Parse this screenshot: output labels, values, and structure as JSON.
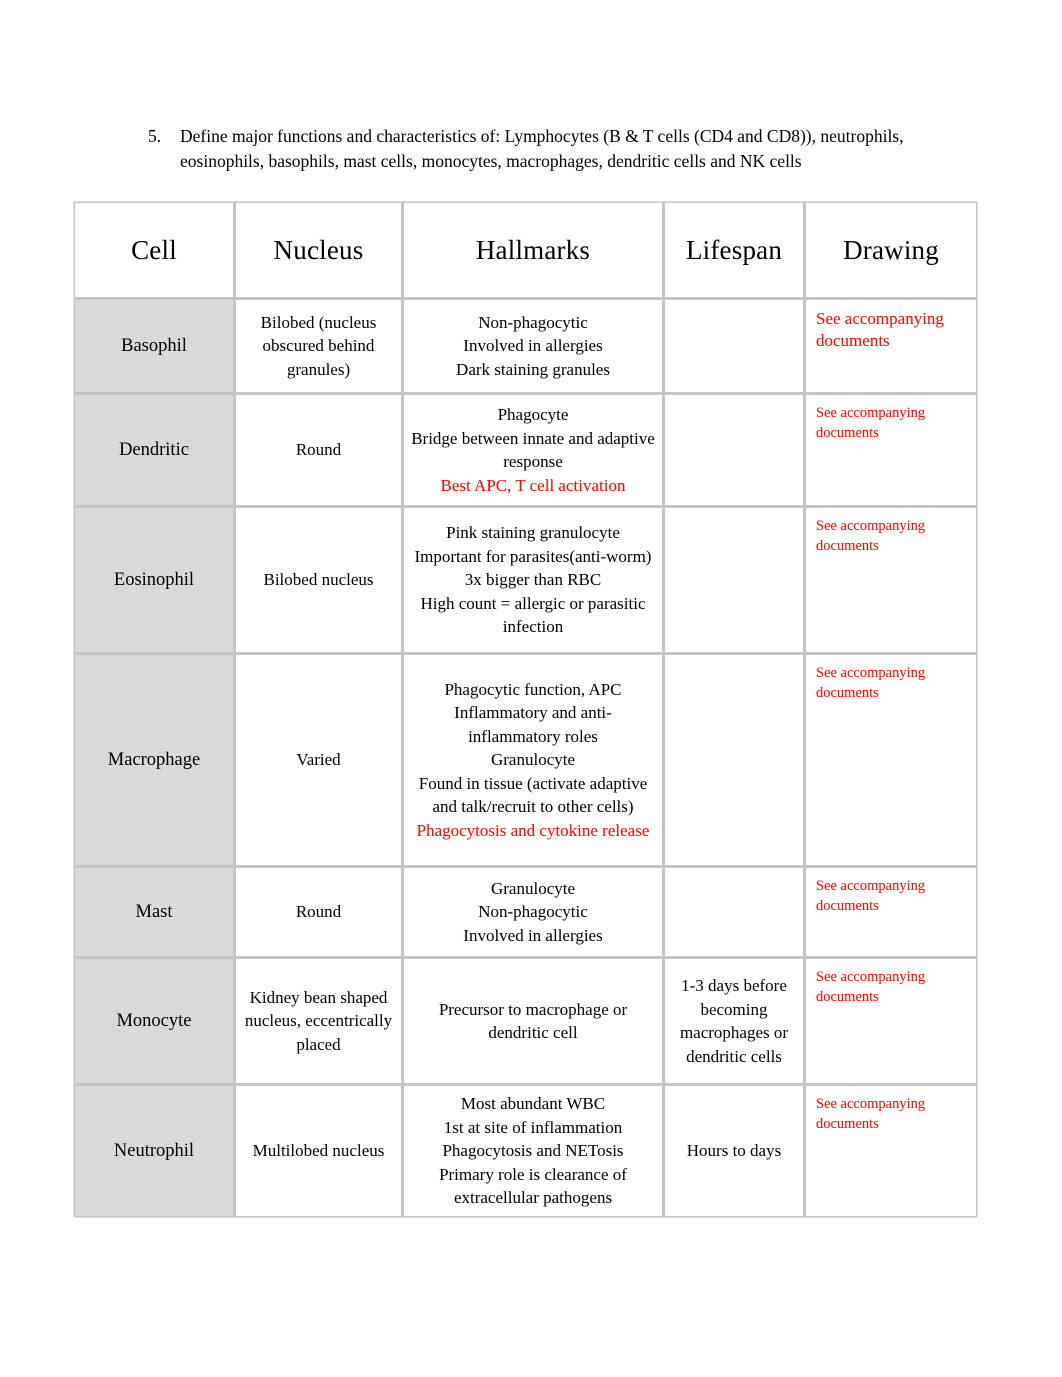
{
  "question": {
    "number": "5.",
    "text": "Define major functions and characteristics of: Lymphocytes (B & T cells (CD4 and CD8)), neutrophils, eosinophils, basophils, mast cells, monocytes, macrophages, dendritic cells and NK cells"
  },
  "colors": {
    "header_bg": "#d9d9d9",
    "first_column_bg": "#d9d9d9",
    "border": "#c4c4c4",
    "accent_red": "#ff0000",
    "text": "#000000"
  },
  "table": {
    "headers": [
      "Cell",
      "Nucleus",
      "Hallmarks",
      "Lifespan",
      "Drawing"
    ],
    "rows": [
      {
        "cell": "Basophil",
        "nucleus": "Bilobed (nucleus obscured behind granules)",
        "hallmarks": [
          "Non-phagocytic",
          "Involved in allergies",
          "Dark staining granules"
        ],
        "hallmarks_red": "",
        "lifespan": "",
        "drawing": "See accompanying documents"
      },
      {
        "cell": "Dendritic",
        "nucleus": "Round",
        "hallmarks": [
          "Phagocyte",
          "Bridge between innate and adaptive response"
        ],
        "hallmarks_red": "Best APC, T cell activation",
        "lifespan": "",
        "drawing": "See accompanying documents"
      },
      {
        "cell": "Eosinophil",
        "nucleus": "Bilobed nucleus",
        "hallmarks": [
          "Pink staining granulocyte",
          "Important for parasites(anti-worm)",
          "3x bigger than RBC",
          "High count = allergic or parasitic infection"
        ],
        "hallmarks_red": "",
        "lifespan": "",
        "drawing": "See accompanying documents"
      },
      {
        "cell": "Macrophage",
        "nucleus": "Varied",
        "hallmarks": [
          "Phagocytic function, APC",
          "Inflammatory and anti-inflammatory roles",
          "Granulocyte",
          "Found in tissue (activate adaptive and talk/recruit to other cells)"
        ],
        "hallmarks_red": "Phagocytosis and cytokine release",
        "lifespan": "",
        "drawing": "See accompanying documents"
      },
      {
        "cell": "Mast",
        "nucleus": "Round",
        "hallmarks": [
          "Granulocyte",
          "Non-phagocytic",
          "Involved in allergies"
        ],
        "hallmarks_red": "",
        "lifespan": "",
        "drawing": "See accompanying documents"
      },
      {
        "cell": "Monocyte",
        "nucleus": "Kidney bean shaped nucleus, eccentrically placed",
        "hallmarks": [
          "Precursor to macrophage or dendritic cell"
        ],
        "hallmarks_red": "",
        "lifespan": "1-3 days before becoming macrophages or dendritic cells",
        "drawing": "See accompanying documents"
      },
      {
        "cell": "Neutrophil",
        "nucleus": "Multilobed nucleus",
        "hallmarks": [
          "Most abundant WBC",
          "1st at site of inflammation",
          "Phagocytosis and NETosis",
          "Primary role is clearance of extracellular pathogens"
        ],
        "hallmarks_red": "",
        "lifespan": "Hours to days",
        "drawing": "See accompanying documents"
      }
    ]
  }
}
